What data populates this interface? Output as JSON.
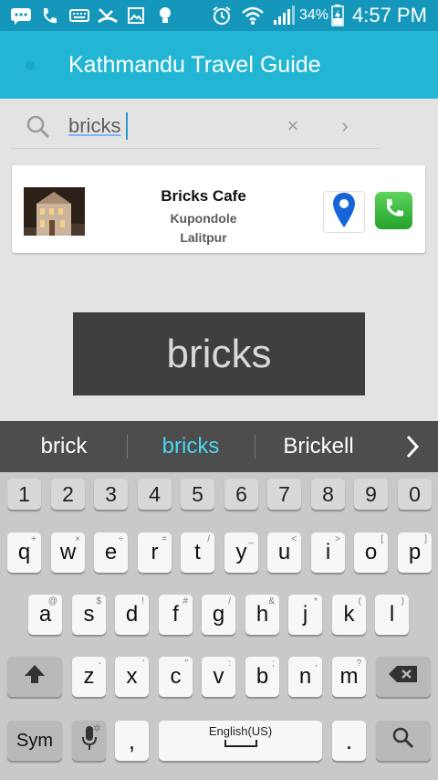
{
  "status_bar": {
    "battery": "34%",
    "time": "4:57 PM",
    "icons": [
      "chat-icon",
      "phone-icon",
      "keyboard-icon",
      "missed-call-icon",
      "image-icon",
      "bulb-icon",
      "alarm-icon",
      "wifi-icon",
      "signal-icon",
      "battery-icon"
    ]
  },
  "app_bar": {
    "title": "Kathmandu Travel Guide"
  },
  "search": {
    "value": "bricks",
    "clear_label": "×",
    "go_label": "›"
  },
  "result": {
    "name": "Bricks Cafe",
    "line1": "Kupondole",
    "line2": "Lalitpur",
    "colors": {
      "map_pin": "#1565d8",
      "call": "#2fb332"
    }
  },
  "toast": {
    "text": "bricks"
  },
  "suggestions": [
    "brick",
    "bricks",
    "Brickell"
  ],
  "suggestion_highlight_color": "#4cd6f0",
  "keyboard": {
    "numbers": [
      "1",
      "2",
      "3",
      "4",
      "5",
      "6",
      "7",
      "8",
      "9",
      "0"
    ],
    "row1": [
      {
        "k": "q",
        "h": "+"
      },
      {
        "k": "w",
        "h": "×"
      },
      {
        "k": "e",
        "h": "÷"
      },
      {
        "k": "r",
        "h": "="
      },
      {
        "k": "t",
        "h": "/"
      },
      {
        "k": "y",
        "h": "_"
      },
      {
        "k": "u",
        "h": "<"
      },
      {
        "k": "i",
        "h": ">"
      },
      {
        "k": "o",
        "h": "["
      },
      {
        "k": "p",
        "h": "]"
      }
    ],
    "row2": [
      {
        "k": "a",
        "h": "@"
      },
      {
        "k": "s",
        "h": "$"
      },
      {
        "k": "d",
        "h": "!"
      },
      {
        "k": "f",
        "h": "#"
      },
      {
        "k": "g",
        "h": "/"
      },
      {
        "k": "h",
        "h": "&"
      },
      {
        "k": "j",
        "h": "*"
      },
      {
        "k": "k",
        "h": "("
      },
      {
        "k": "l",
        "h": ")"
      }
    ],
    "row3": [
      {
        "k": "z",
        "h": "-"
      },
      {
        "k": "x",
        "h": "'"
      },
      {
        "k": "c",
        "h": "\""
      },
      {
        "k": "v",
        "h": ":"
      },
      {
        "k": "b",
        "h": ";"
      },
      {
        "k": "n",
        "h": ","
      },
      {
        "k": "m",
        "h": "?"
      }
    ],
    "sym_label": "Sym",
    "comma_label": ",",
    "space_label": "English(US)",
    "period_label": ".",
    "shift_icon": "shift-icon",
    "backspace_icon": "backspace-icon",
    "mic_icon": "microphone-icon",
    "search_icon": "search-icon"
  }
}
